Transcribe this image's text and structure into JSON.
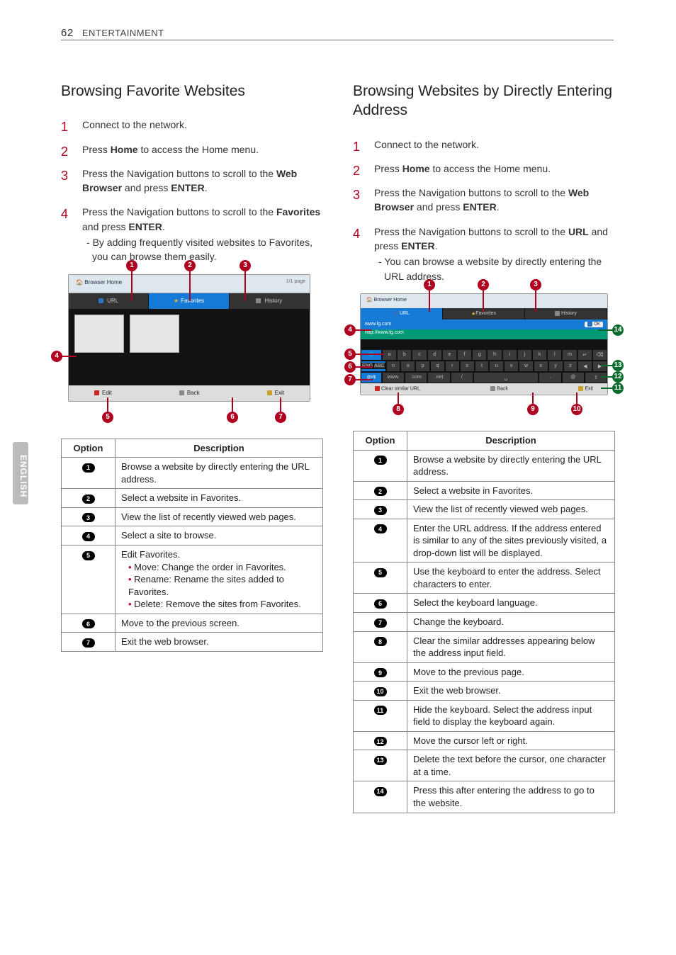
{
  "header": {
    "page_number": "62",
    "section": "ENTERTAINMENT"
  },
  "sidetab": "ENGLISH",
  "left": {
    "title": "Browsing Favorite Websites",
    "steps": {
      "s1": "Connect to the network.",
      "s2a": "Press ",
      "s2b": "Home",
      "s2c": " to access the Home menu.",
      "s3a": "Press the Navigation buttons to scroll to the ",
      "s3b": "Web Browser",
      "s3c": " and press ",
      "s3d": "ENTER",
      "s3e": ".",
      "s4a": "Press the Navigation buttons to scroll to the ",
      "s4b": "Favorites",
      "s4c": " and press ",
      "s4d": "ENTER",
      "s4e": ".",
      "s4sub": "By adding frequently visited websites to Favorites, you can browse them easily."
    },
    "fig": {
      "browser_home": "Browser Home",
      "url": "URL",
      "favorites": "Favorites",
      "history": "History",
      "page": "1/1 page",
      "edit": "Edit",
      "back": "Back",
      "exit": "Exit"
    },
    "callouts": {
      "c1": "1",
      "c2": "2",
      "c3": "3",
      "c4": "4",
      "c5": "5",
      "c6": "6",
      "c7": "7"
    },
    "table": {
      "h1": "Option",
      "h2": "Description",
      "r1": "Browse a website by directly entering the URL address.",
      "r2": "Select a website in Favorites.",
      "r3": "View the list of recently viewed web pages.",
      "r4": "Select a site to browse.",
      "r5a": "Edit Favorites.",
      "r5b": "Move: Change the order in Favorites.",
      "r5c": "Rename: Rename the sites added to Favorites.",
      "r5d": "Delete: Remove the sites from Favorites.",
      "r6": "Move to the previous screen.",
      "r7": "Exit the web browser."
    }
  },
  "right": {
    "title": "Browsing Websites by Directly Entering Address",
    "steps": {
      "s1": "Connect to the network.",
      "s2a": "Press ",
      "s2b": "Home",
      "s2c": " to access the Home menu.",
      "s3a": "Press the Navigation buttons to scroll to the ",
      "s3b": "Web Browser",
      "s3c": " and press ",
      "s3d": "ENTER",
      "s3e": ".",
      "s4a": "Press the Navigation buttons to scroll to the ",
      "s4b": "URL",
      "s4c": " and press ",
      "s4d": "ENTER",
      "s4e": ".",
      "s4sub": "You can browse a website by directly entering the URL address."
    },
    "fig": {
      "browser_home": "Browser Home",
      "url": "URL",
      "favorites": "Favorites",
      "history": "History",
      "addr1": "www.lg.com",
      "ok": "OK",
      "addr2": "http://www.lg.com",
      "keys": {
        "row1": [
          "a",
          "b",
          "c",
          "d",
          "e",
          "f",
          "g",
          "h",
          "i",
          "j",
          "k",
          "l",
          "m"
        ],
        "row2": [
          "n",
          "o",
          "p",
          "q",
          "r",
          "s",
          "t",
          "u",
          "v",
          "w",
          "x",
          "y",
          "z"
        ],
        "lab1": "ENG",
        "lab2": "ABC",
        "lab3": "@#$",
        "b_www": "www.",
        "b_com": ".com",
        "b_net": ".net",
        "b_sl": "/",
        "b_sp": "␣",
        "b_dot": ".",
        "b_at": "@",
        "b_up": "⇧"
      },
      "clear": "Clear similar URL",
      "back": "Back",
      "exit": "Exit"
    },
    "callouts": {
      "c1": "1",
      "c2": "2",
      "c3": "3",
      "c4": "4",
      "c5": "5",
      "c6": "6",
      "c7": "7",
      "c8": "8",
      "c9": "9",
      "c10": "10",
      "c11": "11",
      "c12": "12",
      "c13": "13",
      "c14": "14"
    },
    "table": {
      "h1": "Option",
      "h2": "Description",
      "r1": "Browse a website by directly entering the URL address.",
      "r2": "Select a website in Favorites.",
      "r3": "View the list of recently viewed web pages.",
      "r4": "Enter the URL address. If the address entered is similar to any of the sites previously visited, a drop-down list will be displayed.",
      "r5": "Use the keyboard to enter the address. Select characters to enter.",
      "r6": "Select the keyboard language.",
      "r7": "Change the keyboard.",
      "r8": "Clear the similar addresses appearing below the address input field.",
      "r9": "Move to the previous page.",
      "r10": "Exit the web browser.",
      "r11": "Hide the keyboard. Select the address input field to display the keyboard again.",
      "r12": "Move the cursor left or right.",
      "r13": "Delete the text before the cursor, one character at a time.",
      "r14": "Press this after entering the address to go to the website."
    }
  }
}
